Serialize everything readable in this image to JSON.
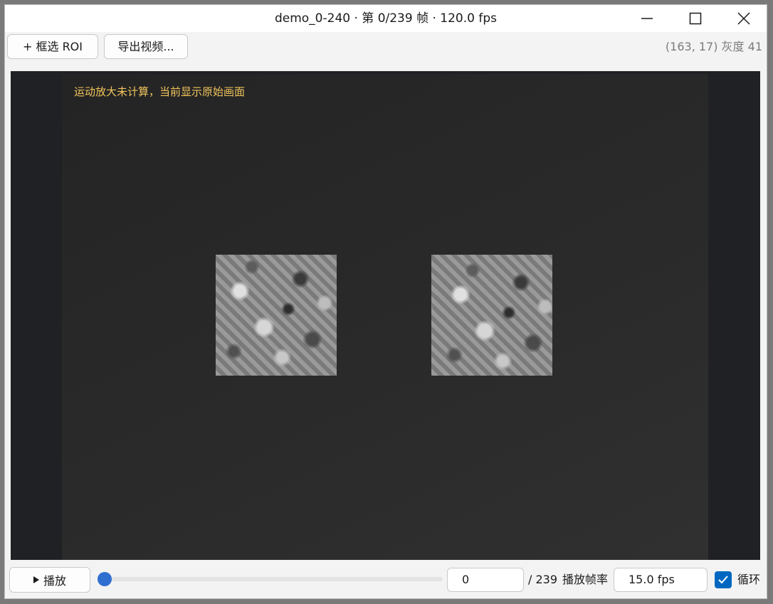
{
  "window": {
    "title": "demo_0-240 · 第 0/239 帧 · 120.0 fps",
    "controls": [
      "minimize-icon",
      "maximize-icon",
      "close-icon"
    ]
  },
  "toolbar": {
    "roi_button": "+ 框选 ROI",
    "export_button": "导出视频...",
    "cursor_readout": "(163, 17) 灰度 41"
  },
  "viewer": {
    "overlay_message": "运动放大未计算，当前显示原始画面",
    "overlay_color": "#f2c55c"
  },
  "playback": {
    "play_button": "播放",
    "play_icon": "play-triangle-icon",
    "slider_value": 0,
    "slider_max": 239,
    "frame_value": "0",
    "total_frames": "/ 239",
    "rate_label": "播放帧率",
    "fps_value": "15.0 fps",
    "loop_checked": true,
    "loop_label": "循环",
    "accent": "#2f6fd0"
  }
}
